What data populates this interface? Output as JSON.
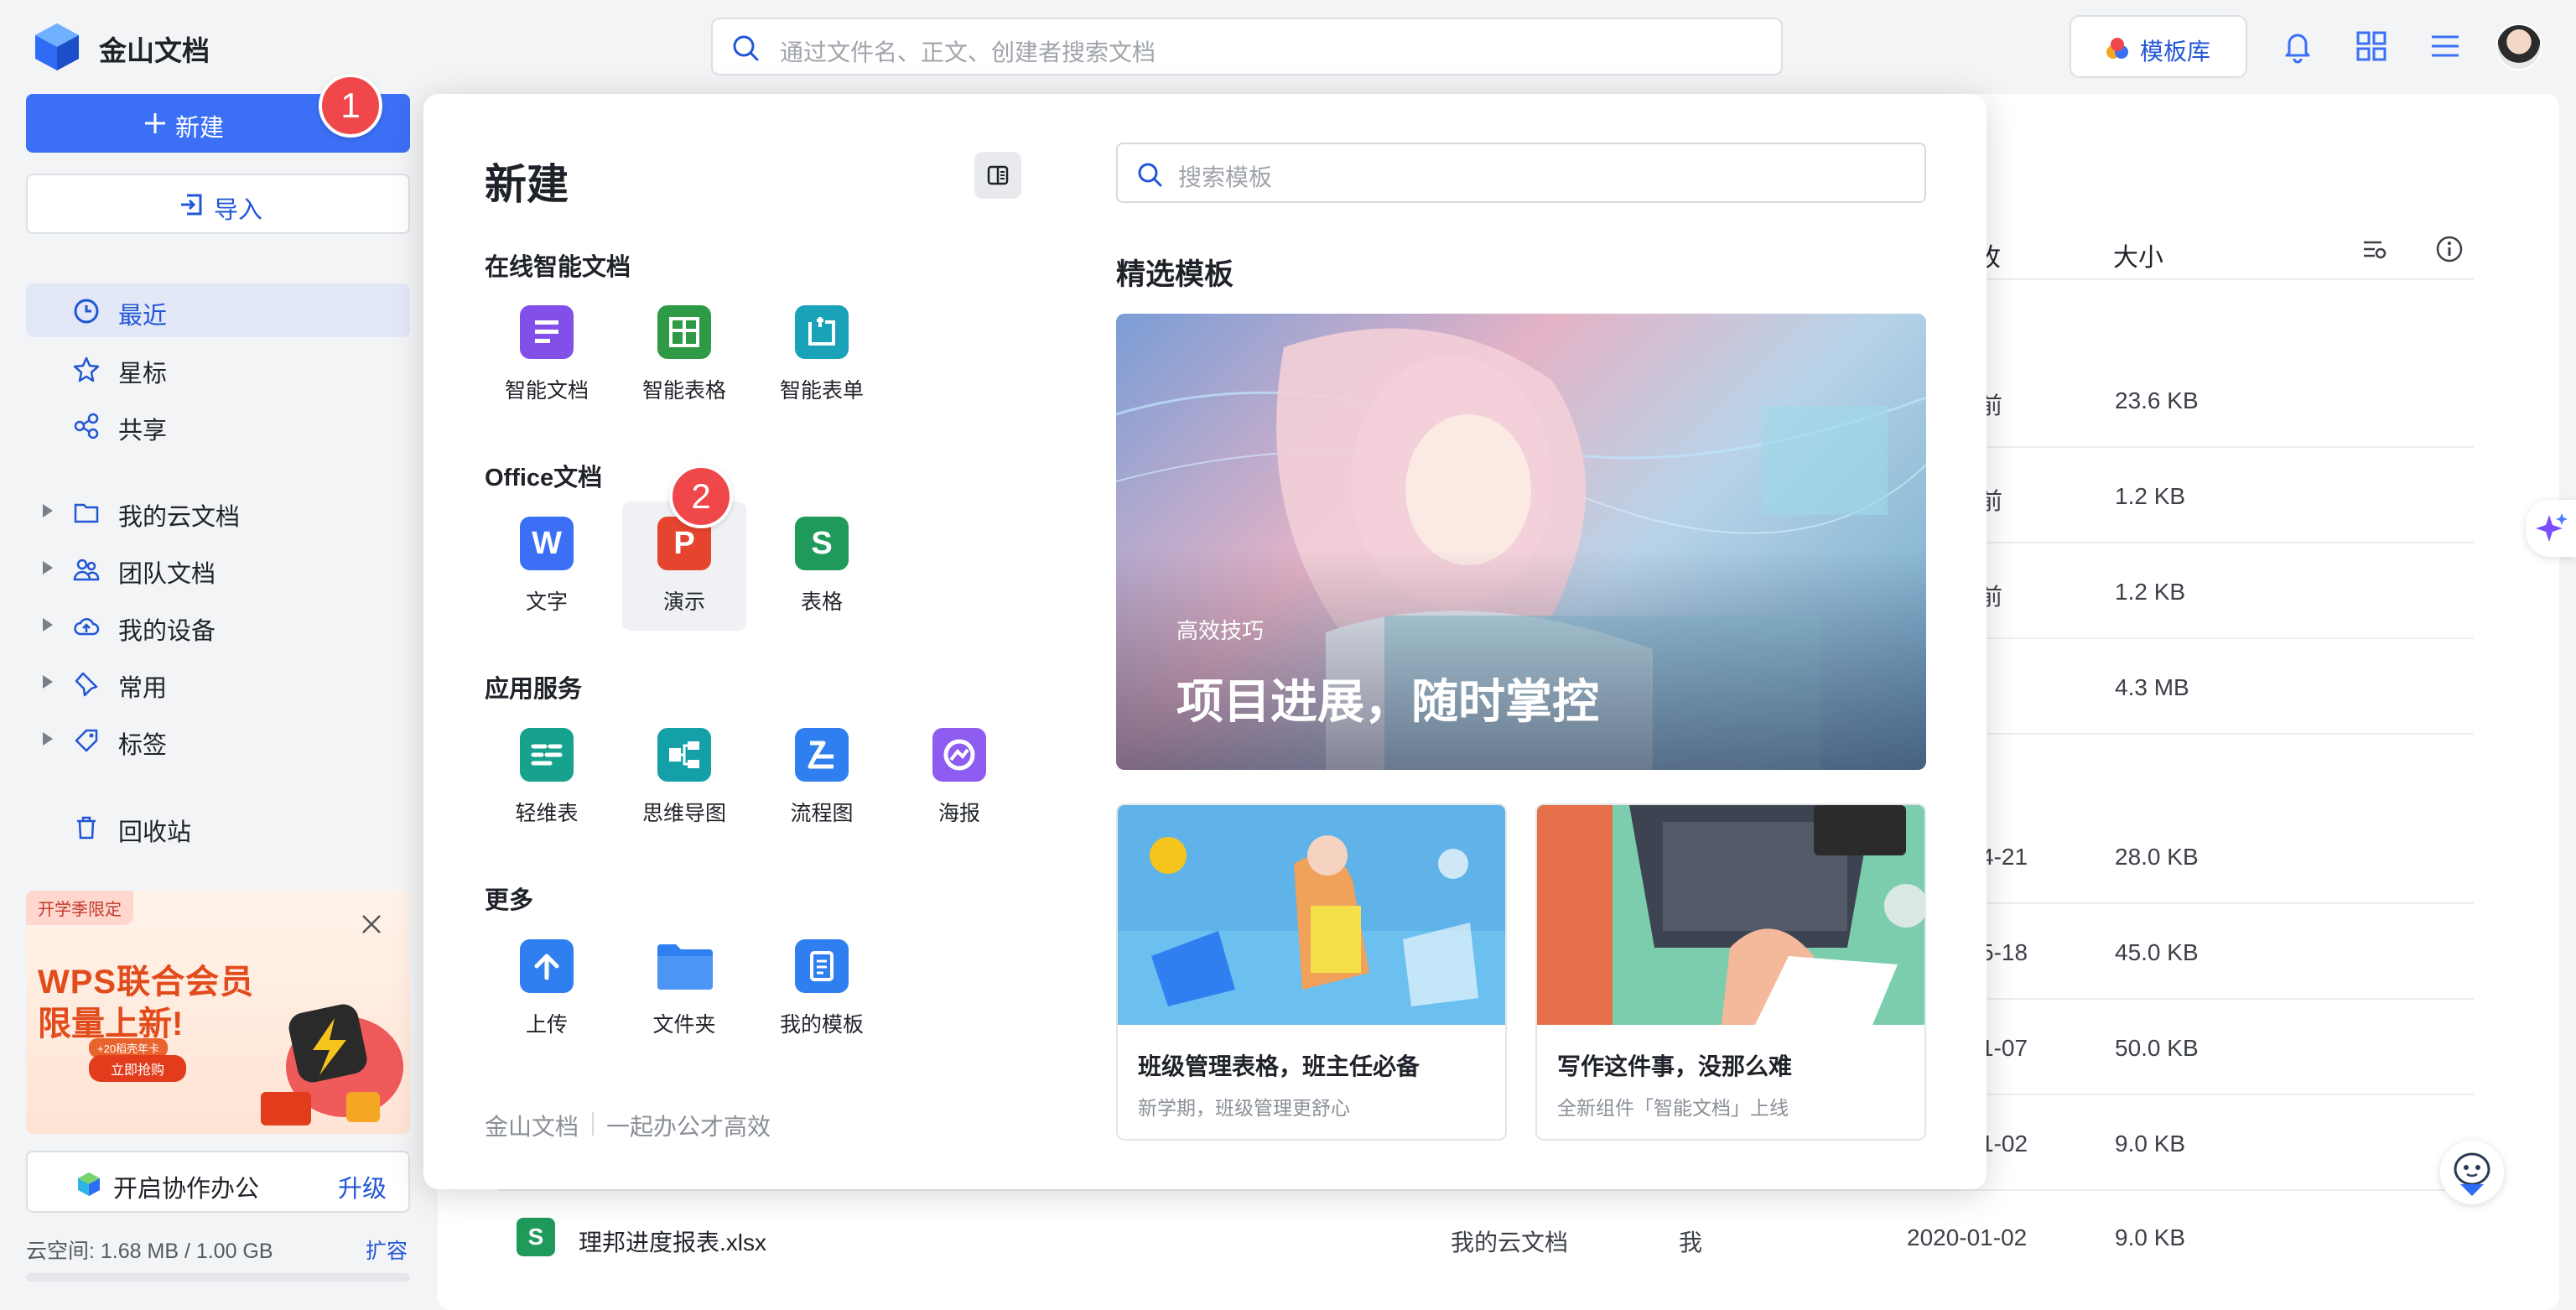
{
  "app": {
    "title": "金山文档"
  },
  "search": {
    "placeholder": "通过文件名、正文、创建者搜索文档"
  },
  "header": {
    "template_button": "模板库"
  },
  "sidebar": {
    "new_label": "新建",
    "import_label": "导入",
    "new_badge": "1",
    "items": [
      {
        "label": "最近"
      },
      {
        "label": "星标"
      },
      {
        "label": "共享"
      },
      {
        "label": "我的云文档"
      },
      {
        "label": "团队文档"
      },
      {
        "label": "我的设备"
      },
      {
        "label": "常用"
      },
      {
        "label": "标签"
      },
      {
        "label": "回收站"
      }
    ],
    "promo": {
      "tag": "开学季限定",
      "line1": "WPS联合会员",
      "line2": "限量上新!",
      "small": "+20稻壳年卡",
      "cta": "立即抢购"
    },
    "coop_label": "开启协作办公",
    "upgrade_label": "升级",
    "storage": "云空间: 1.68 MB / 1.00 GB",
    "expand_label": "扩容"
  },
  "file_list": {
    "col_size": "大小",
    "col_partial": "收",
    "rows": [
      {
        "date_partial": "前",
        "size": "23.6 KB"
      },
      {
        "date_partial": "前",
        "size": "1.2 KB"
      },
      {
        "date_partial": "前",
        "size": "1.2 KB"
      },
      {
        "date_partial": "",
        "size": "4.3 MB"
      },
      {
        "date_partial": "4-21",
        "size": "28.0 KB"
      },
      {
        "date_partial": "5-18",
        "size": "45.0 KB"
      },
      {
        "date_partial": "1-07",
        "size": "50.0 KB"
      },
      {
        "date_partial": "1-02",
        "size": "9.0 KB"
      }
    ],
    "last_row": {
      "name": "理邦进度报表.xlsx",
      "location": "我的云文档",
      "owner": "我",
      "date": "2020-01-02",
      "size": "9.0 KB",
      "icon": "S"
    }
  },
  "new_menu": {
    "title": "新建",
    "sections": [
      {
        "title": "在线智能文档",
        "items": [
          {
            "label": "智能文档",
            "color": "#8250e8"
          },
          {
            "label": "智能表格",
            "color": "#2f9a45"
          },
          {
            "label": "智能表单",
            "color": "#1aa3b8"
          }
        ]
      },
      {
        "title": "Office文档",
        "items": [
          {
            "label": "文字",
            "letter": "W",
            "color": "#3b6ff5"
          },
          {
            "label": "演示",
            "letter": "P",
            "color": "#e5452f"
          },
          {
            "label": "表格",
            "letter": "S",
            "color": "#1f9a5b"
          }
        ]
      },
      {
        "title": "应用服务",
        "items": [
          {
            "label": "轻维表",
            "color": "#16a28c"
          },
          {
            "label": "思维导图",
            "color": "#14a0a8"
          },
          {
            "label": "流程图",
            "color": "#2f7ff0"
          },
          {
            "label": "海报",
            "color": "#8e5cf0"
          }
        ]
      },
      {
        "title": "更多",
        "items": [
          {
            "label": "上传",
            "color": "#2f7ff0"
          },
          {
            "label": "文件夹",
            "color": "#2f7ff0"
          },
          {
            "label": "我的模板",
            "color": "#2f7ff0"
          }
        ]
      }
    ],
    "badge2": "2",
    "footer_brand": "金山文档",
    "footer_slogan": "一起办公才高效",
    "template_search_placeholder": "搜索模板",
    "featured_title": "精选模板",
    "hero": {
      "eyebrow": "高效技巧",
      "title": "项目进展，随时掌控"
    },
    "cards": [
      {
        "title": "班级管理表格，班主任必备",
        "subtitle": "新学期，班级管理更舒心"
      },
      {
        "title": "写作这件事，没那么难",
        "subtitle": "全新组件「智能文档」上线"
      }
    ]
  },
  "colors": {
    "accent": "#3b6ff5",
    "badge": "#f0474b"
  }
}
